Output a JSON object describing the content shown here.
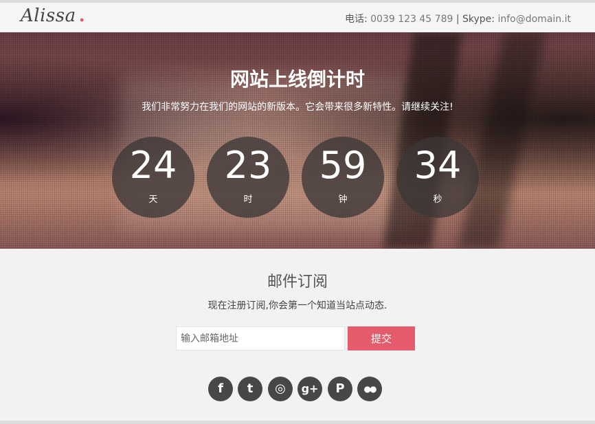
{
  "header": {
    "logo_text": "Alissa",
    "logo_dot": ".",
    "phone_label": "电话:",
    "phone": "0039 123 45 789",
    "separator": "|",
    "skype_label": "Skype:",
    "skype": "info@domain.it"
  },
  "hero": {
    "title": "网站上线倒计时",
    "subtitle": "我们非常努力在我们的网站的新版本。它会带来很多新特性。请继续关注!",
    "countdown": [
      {
        "value": "24",
        "unit": "天"
      },
      {
        "value": "23",
        "unit": "时"
      },
      {
        "value": "59",
        "unit": "钟"
      },
      {
        "value": "34",
        "unit": "秒"
      }
    ]
  },
  "subscribe": {
    "title": "邮件订阅",
    "description": "现在注册订阅,你会第一个知道当站点动态.",
    "email_placeholder": "输入邮箱地址",
    "submit_label": "提交"
  },
  "social": [
    {
      "icon": "facebook-icon",
      "glyph": "f"
    },
    {
      "icon": "twitter-icon",
      "glyph": "t"
    },
    {
      "icon": "dribbble-icon",
      "glyph": "◎"
    },
    {
      "icon": "google-plus-icon",
      "glyph": "g+"
    },
    {
      "icon": "pinterest-icon",
      "glyph": "P"
    },
    {
      "icon": "flickr-icon",
      "glyph": "●●"
    }
  ]
}
